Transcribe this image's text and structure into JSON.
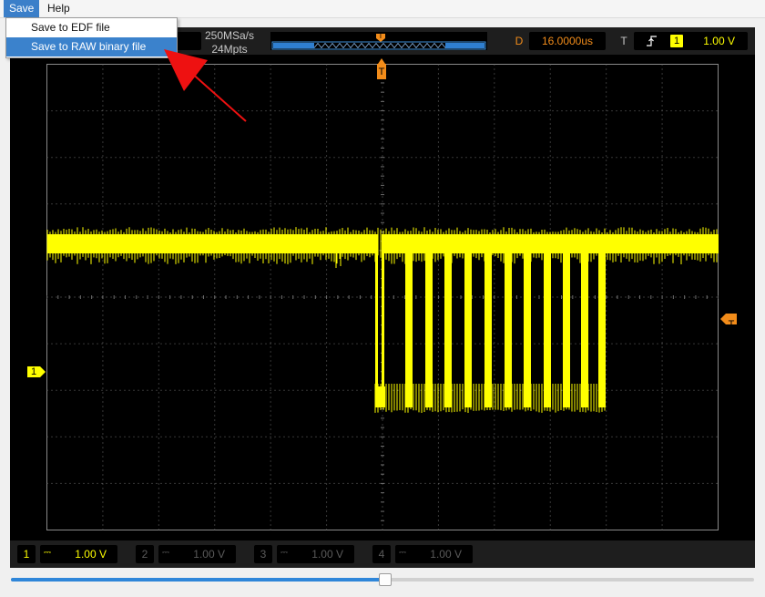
{
  "menubar": {
    "save_label": "Save",
    "help_label": "Help"
  },
  "save_menu": {
    "items": [
      {
        "label": "Save to EDF file"
      },
      {
        "label": "Save to RAW binary file"
      }
    ]
  },
  "topbar": {
    "sample_rate": "250MSa/s",
    "memory_depth": "24Mpts",
    "overview_trigger_marker": "T",
    "delay_label": "D",
    "delay_value": "16.0000us",
    "trigger_label": "T",
    "trigger_channel": "1",
    "trigger_level": "1.00 V",
    "trigger_edge_icon": "rising-edge-icon"
  },
  "plot": {
    "trigger_position_marker": "T",
    "trigger_level_marker": "T",
    "channel1_ground_marker": "1"
  },
  "channels": [
    {
      "number": "1",
      "coupling": "DC",
      "volts_per_div": "1.00 V",
      "color": "#ffff00",
      "active": true
    },
    {
      "number": "2",
      "coupling": "DC",
      "volts_per_div": "1.00 V",
      "color": "#5a5a5a",
      "active": false
    },
    {
      "number": "3",
      "coupling": "DC",
      "volts_per_div": "1.00 V",
      "color": "#5a5a5a",
      "active": false
    },
    {
      "number": "4",
      "coupling": "DC",
      "volts_per_div": "1.00 V",
      "color": "#5a5a5a",
      "active": false
    }
  ],
  "timeline": {
    "position_fraction": 0.5
  },
  "colors": {
    "trace": "#ffff00",
    "trigger": "#f28c1a",
    "grid": "#6e6e6e",
    "menu_highlight": "#3b82cc",
    "annotation_arrow": "#ee1111"
  }
}
